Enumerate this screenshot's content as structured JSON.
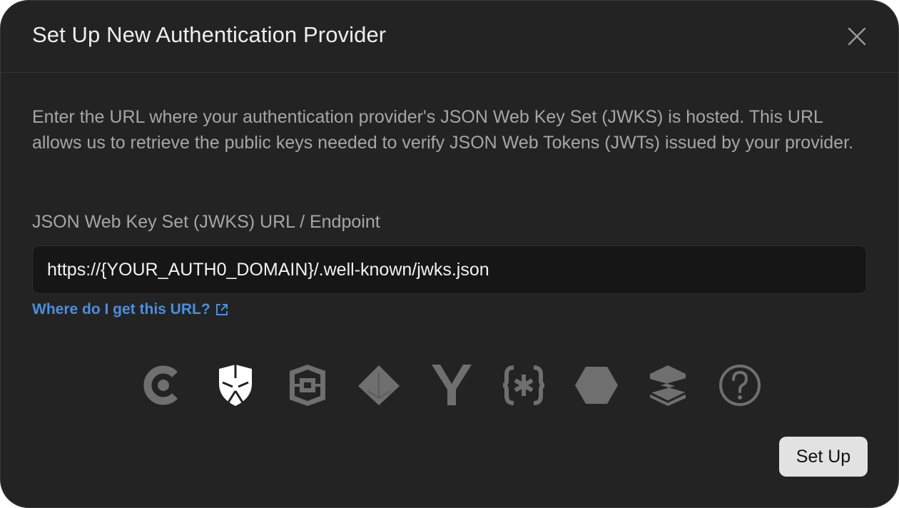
{
  "dialog": {
    "title": "Set Up New Authentication Provider",
    "description": "Enter the URL where your authentication provider's JSON Web Key Set (JWKS) is hosted. This URL allows us to retrieve the public keys needed to verify JSON Web Tokens (JWTs) issued by your provider.",
    "field_label": "JSON Web Key Set (JWKS) URL / Endpoint",
    "url_value": "https://{YOUR_AUTH0_DOMAIN}/.well-known/jwks.json",
    "help_link": "Where do I get this URL?",
    "submit_label": "Set Up"
  },
  "providers": [
    {
      "icon": "clerk-icon",
      "selected": false
    },
    {
      "icon": "auth0-shield-icon",
      "selected": true
    },
    {
      "icon": "aws-cognito-icon",
      "selected": false
    },
    {
      "icon": "firebase-diamond-icon",
      "selected": false
    },
    {
      "icon": "y-logo-icon",
      "selected": false
    },
    {
      "icon": "asterisk-braces-icon",
      "selected": false
    },
    {
      "icon": "hexagon-icon",
      "selected": false
    },
    {
      "icon": "stacked-s-icon",
      "selected": false
    },
    {
      "icon": "question-circle-icon",
      "selected": false
    }
  ],
  "colors": {
    "background": "#232323",
    "text": "#eeeeee",
    "muted": "#a6a6a6",
    "link": "#4a8fe0",
    "icon_inactive": "#6f6f6f",
    "icon_active": "#ffffff",
    "button_bg": "#e2e2e2"
  }
}
